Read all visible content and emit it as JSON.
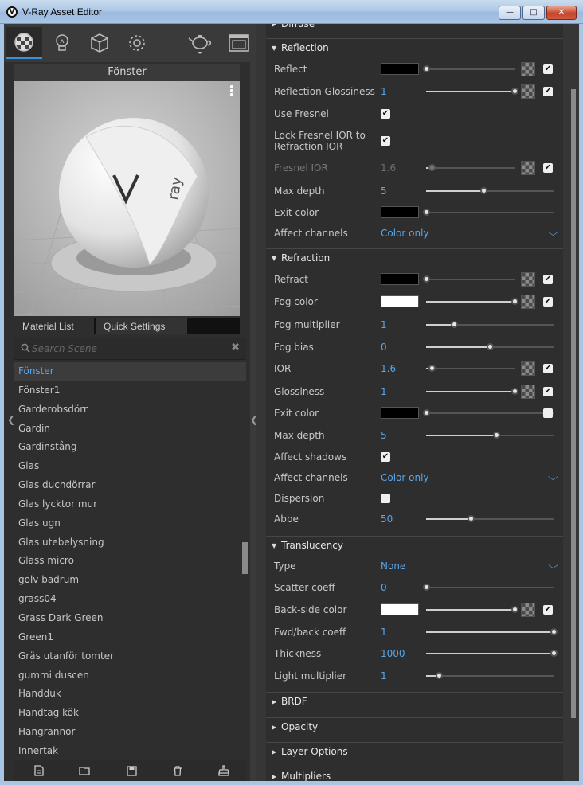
{
  "window": {
    "title": "V-Ray Asset Editor",
    "logo": "V"
  },
  "left": {
    "toolbar": [
      {
        "name": "materials-tab-icon"
      },
      {
        "name": "lights-tab-icon"
      },
      {
        "name": "geometry-tab-icon"
      },
      {
        "name": "settings-tab-icon"
      },
      {
        "name": "teapot-render-icon"
      },
      {
        "name": "frame-buffer-icon"
      }
    ],
    "preview_title": "Fönster",
    "tabs": [
      "Material List",
      "Quick Settings"
    ],
    "search_placeholder": "Search Scene",
    "materials": [
      "Fönster",
      "Fönster1",
      "Garderobsdörr",
      "Gardin",
      "Gardinstång",
      "Glas",
      "Glas duchdörrar",
      "Glas lycktor mur",
      "Glas ugn",
      "Glas utebelysning",
      "Glass micro",
      "golv badrum",
      "grass04",
      "Grass Dark Green",
      "Green1",
      "Gräs utanför tomter",
      "gummi duscen",
      "Handduk",
      "Handtag kök",
      "Hangrannor",
      "Innertak"
    ],
    "selected_index": 0
  },
  "sections": {
    "diffuse": "Diffuse",
    "reflection": "Reflection",
    "refraction": "Refraction",
    "translucency": "Translucency",
    "brdf": "BRDF",
    "opacity": "Opacity",
    "layer_options": "Layer Options",
    "multipliers": "Multipliers"
  },
  "reflection": {
    "reflect": {
      "label": "Reflect",
      "color": "#000000",
      "slider": 0.0
    },
    "glossiness": {
      "label": "Reflection Glossiness",
      "value": "1",
      "slider": 1.0
    },
    "use_fresnel": {
      "label": "Use Fresnel",
      "checked": true
    },
    "lock_fresnel": {
      "label_line1": "Lock Fresnel IOR to",
      "label_line2": "Refraction IOR",
      "checked": true
    },
    "fresnel_ior": {
      "label": "Fresnel IOR",
      "value": "1.6",
      "slider": 0.06
    },
    "max_depth": {
      "label": "Max depth",
      "value": "5",
      "slider": 0.45
    },
    "exit_color": {
      "label": "Exit color",
      "color": "#000000",
      "slider": 0.0
    },
    "affect_channels": {
      "label": "Affect channels",
      "value": "Color only"
    }
  },
  "refraction": {
    "refract": {
      "label": "Refract",
      "color": "#000000",
      "slider": 0.0
    },
    "fog_color": {
      "label": "Fog color",
      "color": "#ffffff",
      "slider": 1.0
    },
    "fog_multiplier": {
      "label": "Fog multiplier",
      "value": "1",
      "slider": 0.22
    },
    "fog_bias": {
      "label": "Fog bias",
      "value": "0",
      "slider": 0.5
    },
    "ior": {
      "label": "IOR",
      "value": "1.6",
      "slider": 0.06
    },
    "glossiness": {
      "label": "Glossiness",
      "value": "1",
      "slider": 1.0
    },
    "exit_color": {
      "label": "Exit color",
      "color": "#000000",
      "slider": 0.0
    },
    "max_depth": {
      "label": "Max depth",
      "value": "5",
      "slider": 0.55
    },
    "affect_shadows": {
      "label": "Affect shadows",
      "checked": true
    },
    "affect_channels": {
      "label": "Affect channels",
      "value": "Color only"
    },
    "dispersion": {
      "label": "Dispersion",
      "checked": false
    },
    "abbe": {
      "label": "Abbe",
      "value": "50",
      "slider": 0.35
    }
  },
  "translucency": {
    "type": {
      "label": "Type",
      "value": "None"
    },
    "scatter": {
      "label": "Scatter coeff",
      "value": "0",
      "slider": 0.0
    },
    "back_color": {
      "label": "Back-side color",
      "color": "#ffffff",
      "slider": 1.0
    },
    "fwd_back": {
      "label": "Fwd/back coeff",
      "value": "1",
      "slider": 1.0
    },
    "thickness": {
      "label": "Thickness",
      "value": "1000",
      "slider": 1.0
    },
    "light_mult": {
      "label": "Light multiplier",
      "value": "1",
      "slider": 0.1
    }
  }
}
